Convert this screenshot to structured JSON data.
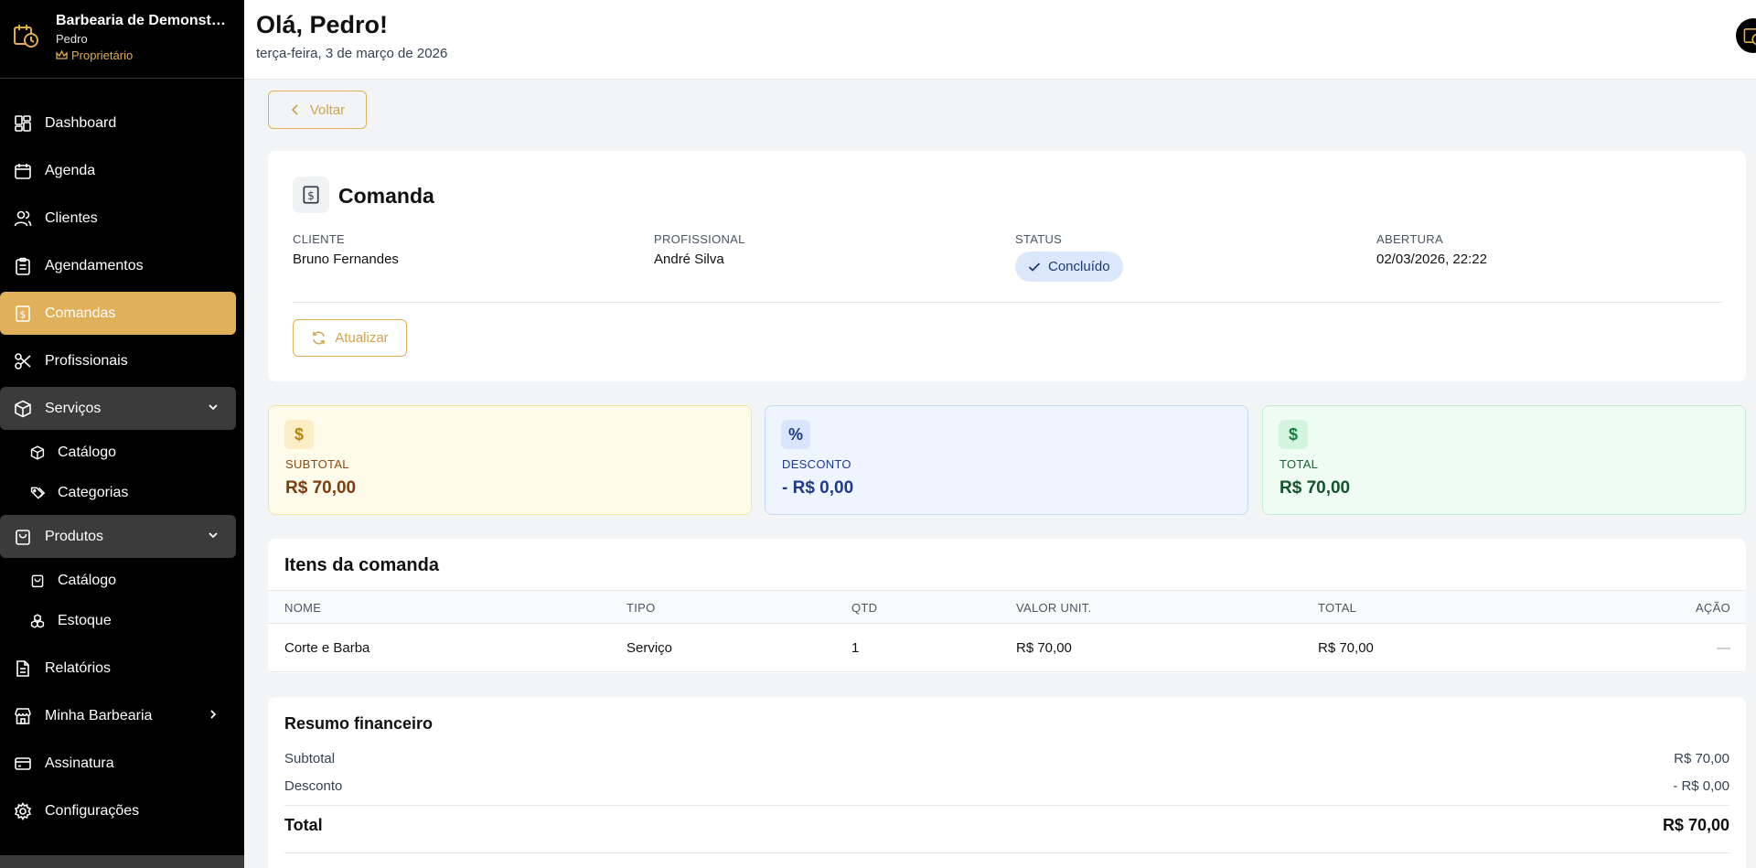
{
  "brand": {
    "name": "Barbearia de Demonstração",
    "user": "Pedro",
    "role": "Proprietário"
  },
  "nav": {
    "dashboard": "Dashboard",
    "agenda": "Agenda",
    "clientes": "Clientes",
    "agendamentos": "Agendamentos",
    "comandas": "Comandas",
    "profissionais": "Profissionais",
    "servicos": "Serviços",
    "servicos_catalogo": "Catálogo",
    "servicos_categorias": "Categorias",
    "produtos": "Produtos",
    "produtos_catalogo": "Catálogo",
    "produtos_estoque": "Estoque",
    "relatorios": "Relatórios",
    "minha_barbearia": "Minha Barbearia",
    "assinatura": "Assinatura",
    "configuracoes": "Configurações"
  },
  "header": {
    "greeting": "Olá, Pedro!",
    "date": "terça-feira, 3 de março de 2026"
  },
  "back_label": "Voltar",
  "comanda": {
    "title": "Comanda",
    "cliente_label": "CLIENTE",
    "cliente": "Bruno Fernandes",
    "profissional_label": "PROFISSIONAL",
    "profissional": "André Silva",
    "status_label": "STATUS",
    "status": "Concluído",
    "abertura_label": "ABERTURA",
    "abertura": "02/03/2026, 22:22",
    "refresh_label": "Atualizar"
  },
  "stats": {
    "subtotal_label": "SUBTOTAL",
    "subtotal": "R$ 70,00",
    "desconto_label": "DESCONTO",
    "desconto": "- R$ 0,00",
    "total_label": "TOTAL",
    "total": "R$ 70,00"
  },
  "items": {
    "title": "Itens da comanda",
    "columns": [
      "NOME",
      "TIPO",
      "QTD",
      "VALOR UNIT.",
      "TOTAL",
      "AÇÃO"
    ],
    "rows": [
      {
        "nome": "Corte e Barba",
        "tipo": "Serviço",
        "qtd": "1",
        "valor": "R$ 70,00",
        "total": "R$ 70,00",
        "acao": "—"
      }
    ]
  },
  "resumo": {
    "title": "Resumo financeiro",
    "subtotal_label": "Subtotal",
    "subtotal": "R$ 70,00",
    "desconto_label": "Desconto",
    "desconto": "- R$ 0,00",
    "total_label": "Total",
    "total": "R$ 70,00"
  },
  "colors": {
    "accent": "#e0b15a",
    "sidebar": "#000000",
    "group_bg": "#3b3b3b"
  }
}
